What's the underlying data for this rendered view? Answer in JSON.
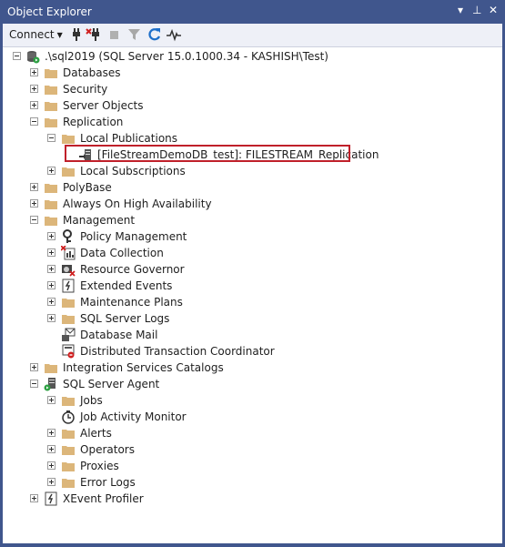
{
  "window": {
    "title": "Object Explorer",
    "pin_glyph": "▾",
    "dock_glyph": "⊥",
    "close_glyph": "✕"
  },
  "toolbar": {
    "connect_label": "Connect"
  },
  "tree": {
    "server": ".\\sql2019 (SQL Server 15.0.1000.34 - KASHISH\\Test)",
    "databases": "Databases",
    "security": "Security",
    "server_objects": "Server Objects",
    "replication": "Replication",
    "local_publications": "Local Publications",
    "publication": "[FileStreamDemoDB_test]: FILESTREAM_Replication",
    "local_subscriptions": "Local Subscriptions",
    "polybase": "PolyBase",
    "always_on": "Always On High Availability",
    "management": "Management",
    "policy_management": "Policy Management",
    "data_collection": "Data Collection",
    "resource_governor": "Resource Governor",
    "extended_events": "Extended Events",
    "maintenance_plans": "Maintenance Plans",
    "sql_server_logs": "SQL Server Logs",
    "database_mail": "Database Mail",
    "dtc": "Distributed Transaction Coordinator",
    "integration_services": "Integration Services Catalogs",
    "sql_server_agent": "SQL Server Agent",
    "jobs": "Jobs",
    "job_activity_monitor": "Job Activity Monitor",
    "alerts": "Alerts",
    "operators": "Operators",
    "proxies": "Proxies",
    "error_logs": "Error Logs",
    "xevent_profiler": "XEvent Profiler"
  },
  "colors": {
    "titlebar": "#40568d",
    "folder": "#dcb67a",
    "highlight_border": "#c0202a"
  }
}
